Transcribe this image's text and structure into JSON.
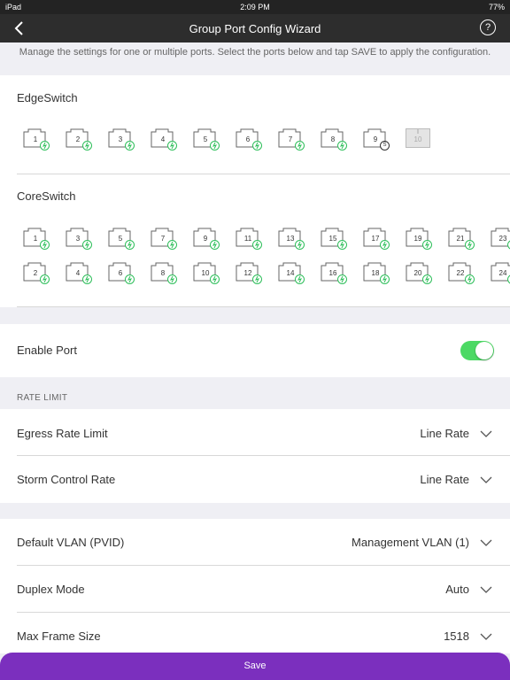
{
  "status": {
    "device": "iPad",
    "time": "2:09 PM",
    "battery": "77%"
  },
  "nav": {
    "title": "Group Port Config Wizard",
    "help": "?"
  },
  "intro_text": "Manage the settings for one or multiple ports. Select the ports below and tap SAVE to apply the configuration.",
  "edge_switch": {
    "title": "EdgeSwitch",
    "ports": [
      {
        "label": "1",
        "badge": "poe"
      },
      {
        "label": "2",
        "badge": "poe"
      },
      {
        "label": "3",
        "badge": "poe"
      },
      {
        "label": "4",
        "badge": "poe"
      },
      {
        "label": "5",
        "badge": "poe"
      },
      {
        "label": "6",
        "badge": "poe"
      },
      {
        "label": "7",
        "badge": "poe"
      },
      {
        "label": "8",
        "badge": "poe"
      },
      {
        "label": "9",
        "badge": "S"
      },
      {
        "label": "10",
        "badge": "disabled"
      }
    ]
  },
  "core_switch": {
    "title": "CoreSwitch",
    "row1": [
      "1",
      "3",
      "5",
      "7",
      "9",
      "11",
      "13",
      "15",
      "17",
      "19",
      "21",
      "23"
    ],
    "row2": [
      "2",
      "4",
      "6",
      "8",
      "10",
      "12",
      "14",
      "16",
      "18",
      "20",
      "22",
      "24"
    ]
  },
  "enable_port": {
    "label": "Enable Port",
    "enabled": true
  },
  "rate_limit": {
    "header": "RATE LIMIT",
    "egress": {
      "label": "Egress Rate Limit",
      "value": "Line Rate"
    },
    "storm": {
      "label": "Storm Control Rate",
      "value": "Line Rate"
    }
  },
  "settings": {
    "vlan": {
      "label": "Default VLAN (PVID)",
      "value": "Management VLAN (1)"
    },
    "duplex": {
      "label": "Duplex Mode",
      "value": "Auto"
    },
    "frame": {
      "label": "Max Frame Size",
      "value": "1518"
    }
  },
  "save_label": "Save",
  "colors": {
    "accent": "#7b2fbe",
    "toggle_on": "#4cd964",
    "poe": "#2fbf5b"
  }
}
